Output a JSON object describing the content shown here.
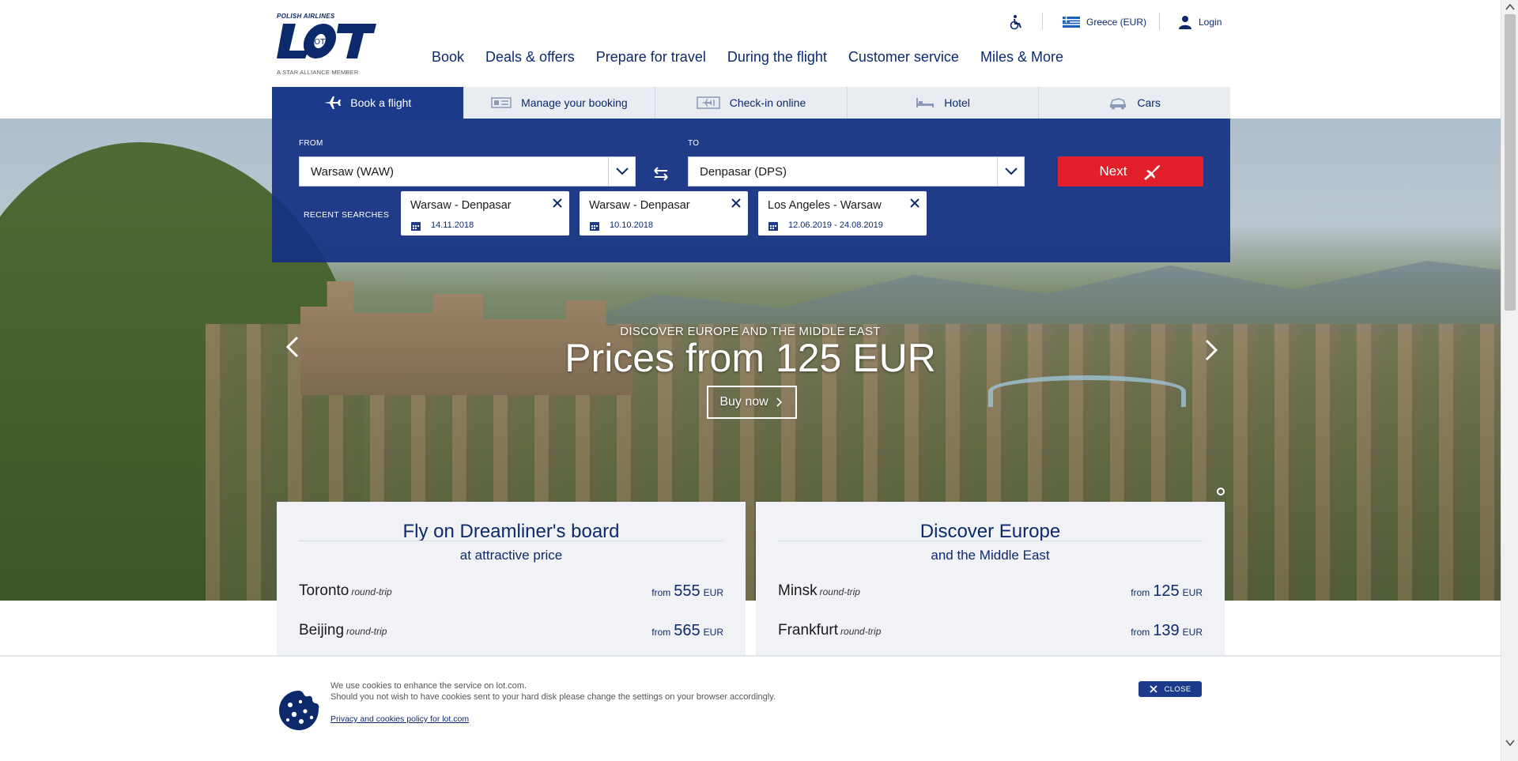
{
  "header": {
    "brand_top": "POLISH AIRLINES",
    "brand_name": "LOT",
    "brand_sub": "A STAR ALLIANCE MEMBER",
    "country": "Greece (EUR)",
    "login": "Login",
    "nav": [
      "Book",
      "Deals & offers",
      "Prepare for travel",
      "During the flight",
      "Customer service",
      "Miles & More"
    ]
  },
  "tabs": [
    {
      "label": "Book a flight",
      "icon": "plane-icon",
      "active": true
    },
    {
      "label": "Manage your booking",
      "icon": "ticket-icon",
      "active": false
    },
    {
      "label": "Check-in online",
      "icon": "boarding-pass-icon",
      "active": false
    },
    {
      "label": "Hotel",
      "icon": "bed-icon",
      "active": false
    },
    {
      "label": "Cars",
      "icon": "car-icon",
      "active": false
    }
  ],
  "booking": {
    "from_label": "FROM",
    "from_value": "Warsaw (WAW)",
    "to_label": "TO",
    "to_value": "Denpasar (DPS)",
    "next_label": "Next",
    "recent_label": "RECENT SEARCHES",
    "recent": [
      {
        "route": "Warsaw - Denpasar",
        "date": "14.11.2018"
      },
      {
        "route": "Warsaw - Denpasar",
        "date": "10.10.2018"
      },
      {
        "route": "Los Angeles - Warsaw",
        "date": "12.06.2019 - 24.08.2019"
      }
    ]
  },
  "hero": {
    "kicker": "DISCOVER EUROPE AND THE MIDDLE EAST",
    "title": "Prices from 125 EUR",
    "cta": "Buy now"
  },
  "promos": [
    {
      "title": "Fly on Dreamliner's board",
      "subtitle": "at attractive price",
      "rows": [
        {
          "city": "Toronto",
          "type": "round-trip",
          "from": "from",
          "price": "555",
          "currency": "EUR"
        },
        {
          "city": "Beijing",
          "type": "round-trip",
          "from": "from",
          "price": "565",
          "currency": "EUR"
        }
      ]
    },
    {
      "title": "Discover Europe",
      "subtitle": "and the Middle East",
      "rows": [
        {
          "city": "Minsk",
          "type": "round-trip",
          "from": "from",
          "price": "125",
          "currency": "EUR"
        },
        {
          "city": "Frankfurt",
          "type": "round-trip",
          "from": "from",
          "price": "139",
          "currency": "EUR"
        }
      ]
    }
  ],
  "cookies": {
    "line1": "We use cookies to enhance the service on lot.com.",
    "line2": "Should you not wish to have cookies sent to your hard disk please change the settings on your browser accordingly.",
    "link": "Privacy and cookies policy for lot.com",
    "close": "CLOSE"
  },
  "colors": {
    "brand_navy": "#0c2a6b",
    "panel_blue": "#1b3a8c",
    "accent_red": "#e21f2a"
  }
}
